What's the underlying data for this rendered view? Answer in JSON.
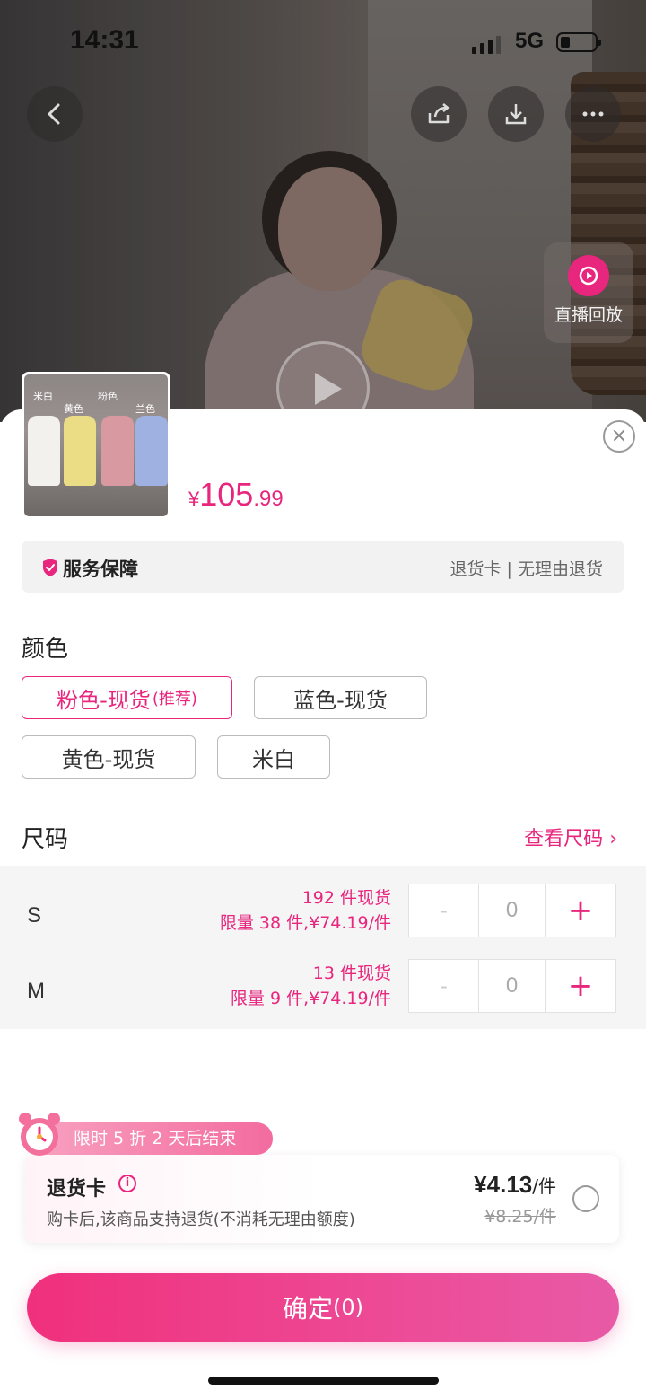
{
  "status_bar": {
    "time": "14:31",
    "network": "5G"
  },
  "replay": {
    "label": "直播回放"
  },
  "product": {
    "price_currency": "¥",
    "price_int": "105",
    "price_dec": ".99",
    "thumb_tags": [
      "米白",
      "黄色",
      "粉色",
      "兰色"
    ]
  },
  "service": {
    "title": "服务保障",
    "right": "退货卡 | 无理由退货"
  },
  "color_section": {
    "title": "颜色",
    "options": [
      {
        "label": "粉色-现货",
        "sub": "(推荐)",
        "selected": true
      },
      {
        "label": "蓝色-现货",
        "sub": "",
        "selected": false
      },
      {
        "label": "黄色-现货",
        "sub": "",
        "selected": false
      },
      {
        "label": "米白",
        "sub": "",
        "selected": false
      }
    ]
  },
  "size_section": {
    "title": "尺码",
    "link": "查看尺码",
    "rows": [
      {
        "name": "S",
        "stock": "192 件现货",
        "limit": "限量 38 件,¥74.19/件",
        "qty": "0",
        "minus": "-",
        "plus": "+"
      },
      {
        "name": "M",
        "stock": "13 件现货",
        "limit": "限量 9 件,¥74.19/件",
        "qty": "0",
        "minus": "-",
        "plus": "+"
      }
    ]
  },
  "promo": {
    "tag": "限时 5 折  2 天后结束"
  },
  "return_card": {
    "title": "退货卡",
    "info_icon": "i",
    "desc": "购卡后,该商品支持退货(不消耗无理由额度)",
    "price": "¥4.13",
    "unit": "/件",
    "original": "¥8.25/件"
  },
  "confirm": {
    "label": "确定",
    "count": "(0)"
  },
  "colors": {
    "accent": "#e8267e",
    "button_start": "#f0307c",
    "button_end": "#e85aa6"
  }
}
